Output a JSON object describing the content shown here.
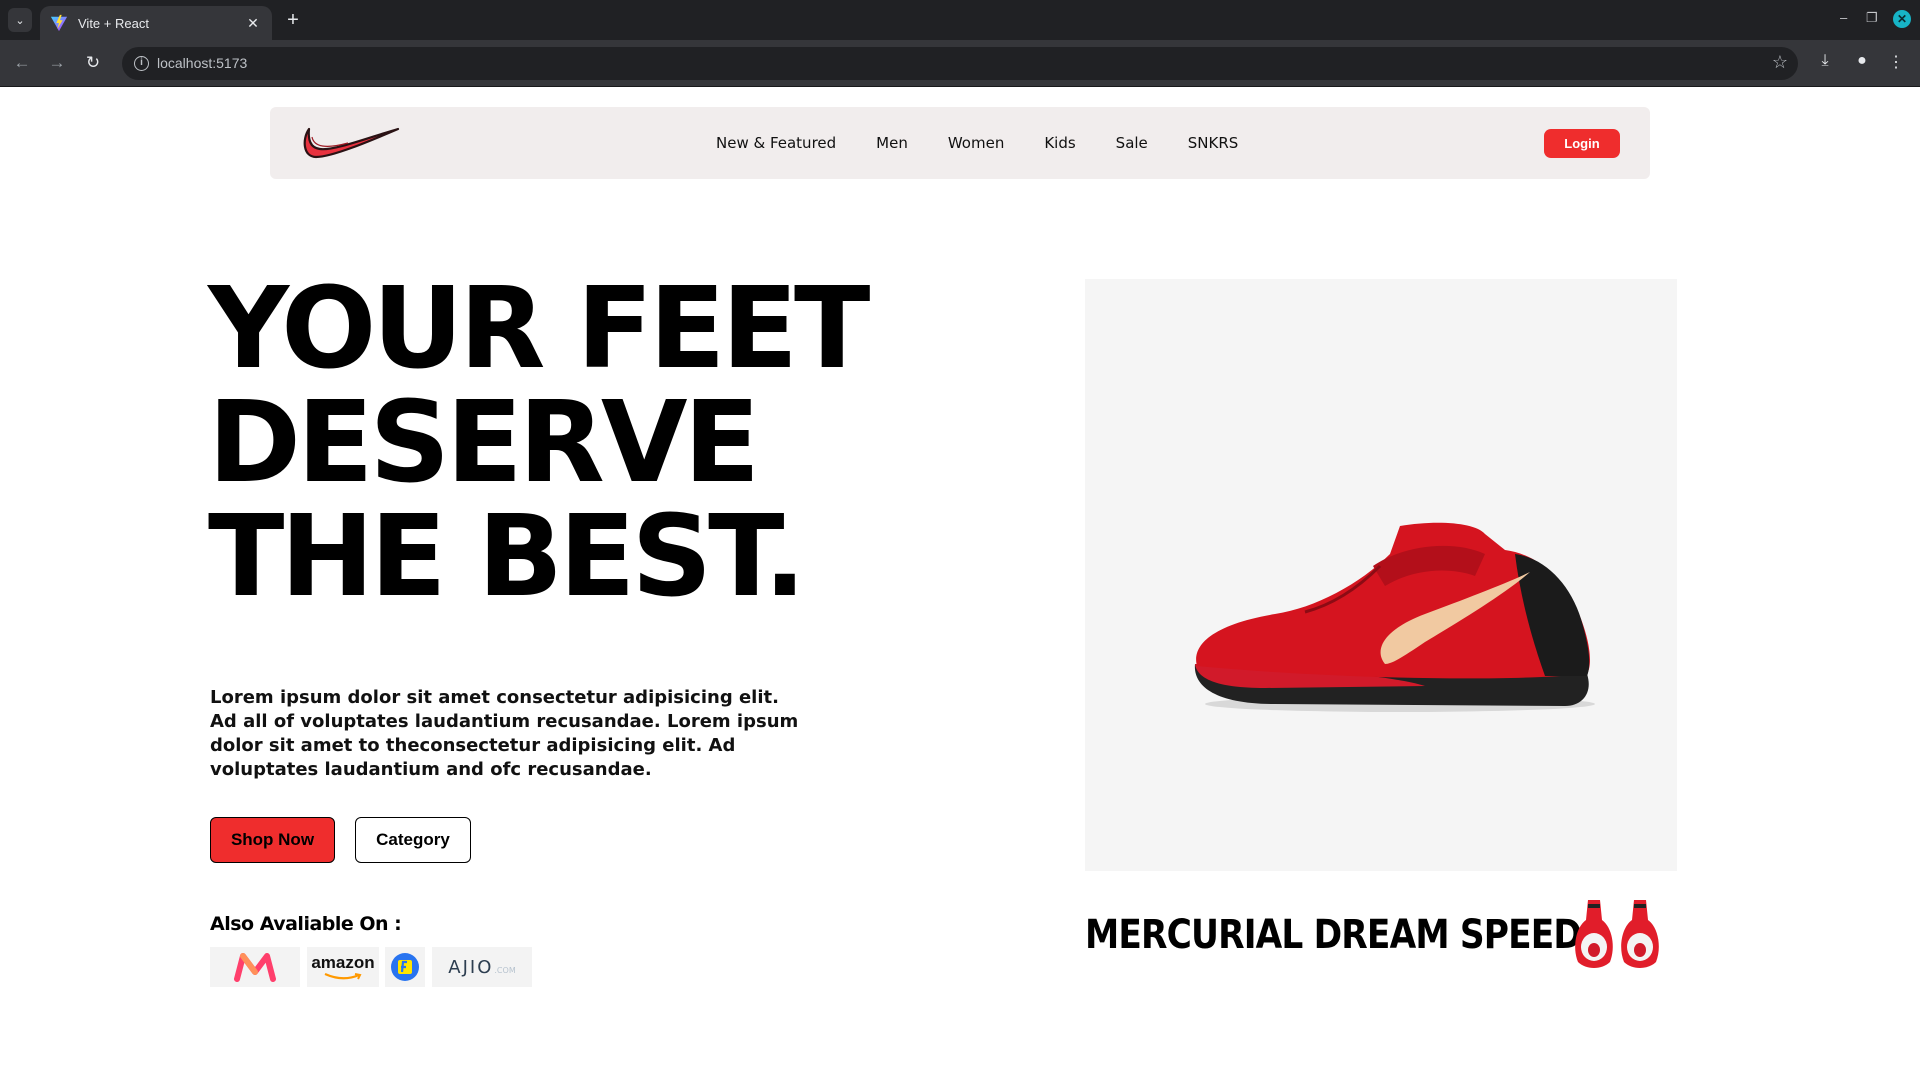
{
  "browser": {
    "tab_title": "Vite + React",
    "url": "localhost:5173"
  },
  "navbar": {
    "logo": "nike-swoosh-logo",
    "links": [
      "New & Featured",
      "Men",
      "Women",
      "Kids",
      "Sale",
      "SNKRS"
    ],
    "login_label": "Login"
  },
  "hero": {
    "title_lines": [
      "YOUR FEET",
      "DESERVE",
      "THE BEST."
    ],
    "description": "Lorem ipsum dolor sit amet consectetur adipisicing elit. Ad all of voluptates laudantium recusandae. Lorem ipsum dolor sit amet to theconsectetur adipisicing elit. Ad voluptates laudantium and ofc recusandae.",
    "shop_now_label": "Shop Now",
    "category_label": "Category",
    "also_available_label": "Also Avaliable On :",
    "stores": {
      "amazon": "amazon",
      "ajio": "AJIO",
      "ajio_suffix": ".COM"
    }
  },
  "product": {
    "name": "MERCURIAL DREAM SPEED"
  },
  "colors": {
    "accent": "#ef2d2d",
    "navbar_bg": "#f1eded",
    "product_bg": "#f5f5f5"
  }
}
